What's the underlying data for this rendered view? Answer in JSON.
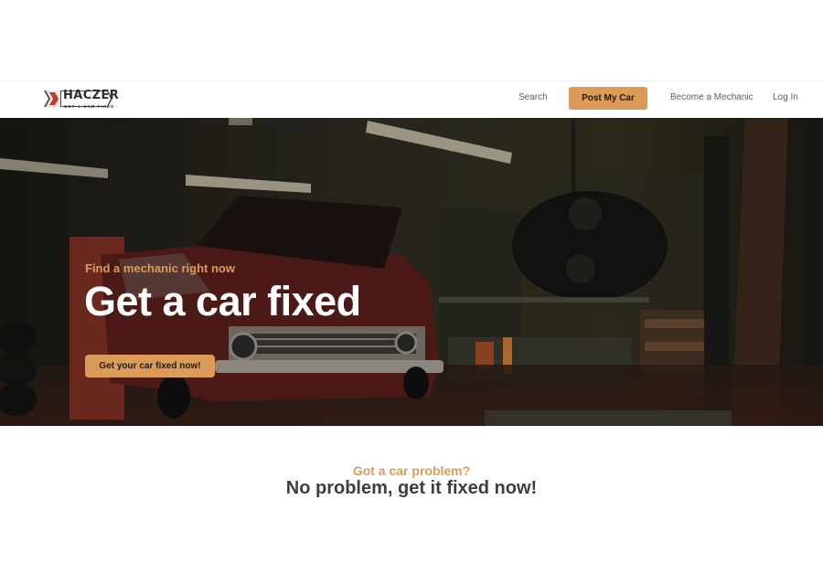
{
  "header": {
    "logo": {
      "word": "HACZER",
      "tagline": "GET A CAR FIXED"
    },
    "nav": {
      "search": "Search",
      "post_my_car": "Post My Car",
      "become_mechanic": "Become a Mechanic",
      "log_in": "Log In"
    }
  },
  "hero": {
    "eyebrow": "Find a mechanic right now",
    "title": "Get a car fixed",
    "cta": "Get your car fixed now!"
  },
  "section": {
    "eyebrow": "Got a car problem?",
    "title": "No problem, get it fixed now!"
  },
  "colors": {
    "accent": "#dc9b58",
    "logo_red": "#c8372d",
    "text_dark": "#3e3e3e"
  }
}
